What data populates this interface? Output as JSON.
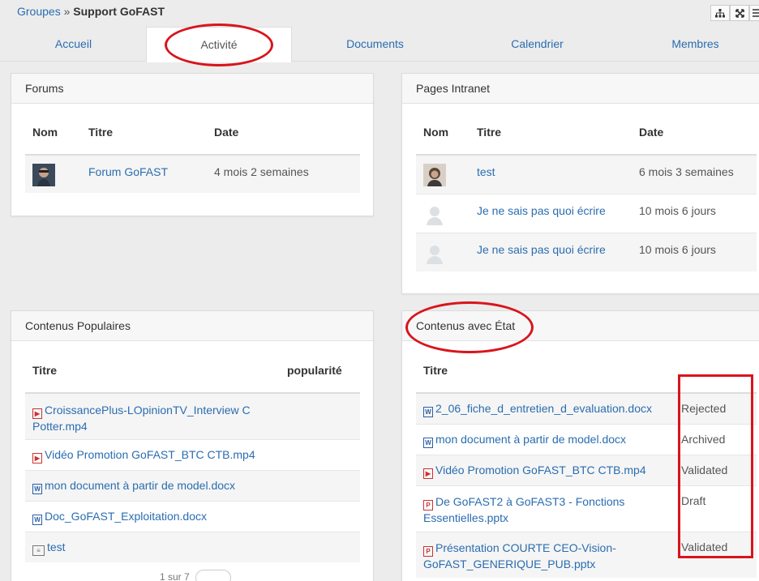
{
  "breadcrumb": {
    "group_link": "Groupes",
    "sep": "»",
    "current": "Support GoFAST"
  },
  "toolbar": {
    "icons": [
      "sitemap-icon",
      "fullscreen-icon",
      "menu-icon"
    ]
  },
  "tabs": [
    {
      "label": "Accueil"
    },
    {
      "label": "Activité"
    },
    {
      "label": "Documents"
    },
    {
      "label": "Calendrier"
    },
    {
      "label": "Membres"
    }
  ],
  "forums": {
    "title": "Forums",
    "headers": {
      "name": "Nom",
      "title": "Titre",
      "date": "Date"
    },
    "rows": [
      {
        "title": "Forum GoFAST",
        "date": "4 mois 2 semaines"
      }
    ]
  },
  "intranet": {
    "title": "Pages Intranet",
    "headers": {
      "name": "Nom",
      "title": "Titre",
      "date": "Date"
    },
    "rows": [
      {
        "title": "test",
        "date": "6 mois 3 semaines"
      },
      {
        "title": "Je ne sais pas quoi écrire",
        "date": "10 mois 6 jours"
      },
      {
        "title": "Je ne sais pas quoi écrire",
        "date": "10 mois 6 jours"
      }
    ]
  },
  "popular": {
    "title": "Contenus Populaires",
    "headers": {
      "title": "Titre",
      "popularity": "popularité"
    },
    "rows": [
      {
        "line1": "CroissancePlus-LOpinionTV_Interview C",
        "line2": "Potter.mp4"
      },
      {
        "line1": "Vidéo Promotion GoFAST_BTC CTB.mp4"
      },
      {
        "line1": "mon document à partir de model.docx"
      },
      {
        "line1": "Doc_GoFAST_Exploitation.docx"
      },
      {
        "line1": "test"
      }
    ],
    "pager": "1 sur 7"
  },
  "state": {
    "title": "Contenus avec État",
    "headers": {
      "title": "Titre"
    },
    "rows": [
      {
        "line1": "2_06_fiche_d_entretien_d_evaluation.docx",
        "status": "Rejected"
      },
      {
        "line1": "mon document à partir de model.docx",
        "status": "Archived"
      },
      {
        "line1": "Vidéo Promotion GoFAST_BTC CTB.mp4",
        "status": "Validated"
      },
      {
        "line1": "De GoFAST2 à GoFAST3 - Fonctions",
        "line2": "Essentielles.pptx",
        "status": "Draft"
      },
      {
        "line1": "Présentation COURTE CEO-Vision-",
        "line2": "GoFAST_GENERIQUE_PUB.pptx",
        "status": "Validated"
      }
    ]
  },
  "colors": {
    "annotation_red": "#d9141c",
    "link_blue": "#2a6db0"
  }
}
